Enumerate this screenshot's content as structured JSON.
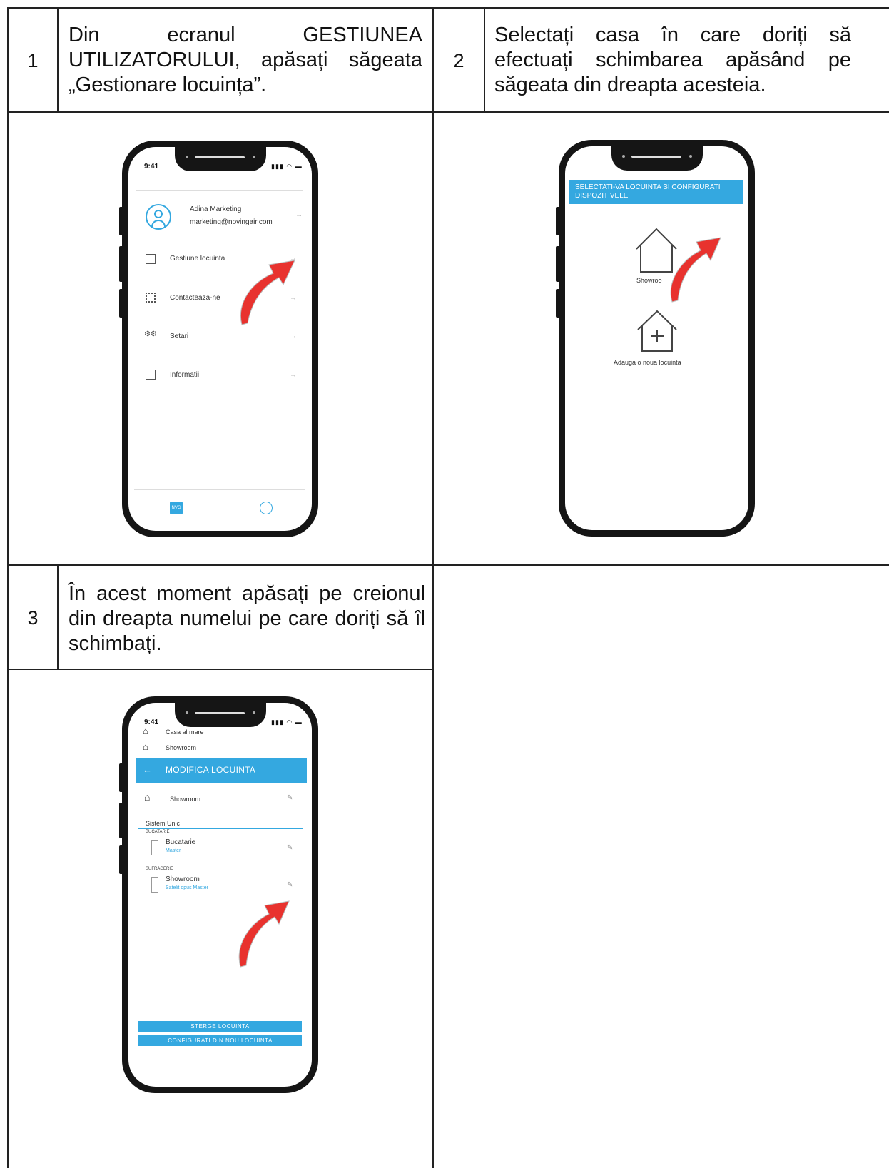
{
  "steps": [
    {
      "num": "1",
      "text": "Din ecranul GESTIUNEA UTILIZATORULUI, apăsați săgeata „Gestionare locuința”."
    },
    {
      "num": "2",
      "text": "Selectați casa în care doriți să efectuați schimbarea apăsând pe săgeata din dreapta acesteia."
    },
    {
      "num": "3",
      "text": "În acest moment apăsați pe creionul din dreapta numelui pe care doriți să îl schimbați."
    }
  ],
  "phone1": {
    "time": "9:41",
    "user_name": "Adina Marketing",
    "user_email": "marketing@novingair.com",
    "menu": [
      {
        "label": "Gestiune locuinta",
        "icon": "house-icon"
      },
      {
        "label": "Contacteaza-ne",
        "icon": "qr-icon"
      },
      {
        "label": "Setari",
        "icon": "gears-icon"
      },
      {
        "label": "Informatii",
        "icon": "info-icon"
      }
    ],
    "nav_logo": "NVG"
  },
  "phone2": {
    "header": "SELECTATI-VA LOCUINTA SI CONFIGURATI DISPOZITIVELE",
    "house_label": "Showroo",
    "add_label": "Adauga o noua locuinta"
  },
  "phone3": {
    "time": "9:41",
    "bg_items": [
      "Casa al mare",
      "Showroom"
    ],
    "header": "MODIFICA LOCUINTA",
    "home_name": "Showroom",
    "system_label": "Sistem Unic",
    "rooms": [
      {
        "room": "BUCATARIE",
        "device": "Bucatarie",
        "role": "Master"
      },
      {
        "room": "SUFRAGERIE",
        "device": "Showroom",
        "role": "Satelit opus Master"
      }
    ],
    "btn_delete": "STERGE LOCUINTA",
    "btn_reconfig": "CONFIGURATI DIN NOU LOCUINTA"
  },
  "colors": {
    "accent": "#34a8e0",
    "arrow": "#e8322e",
    "border": "#222222"
  }
}
